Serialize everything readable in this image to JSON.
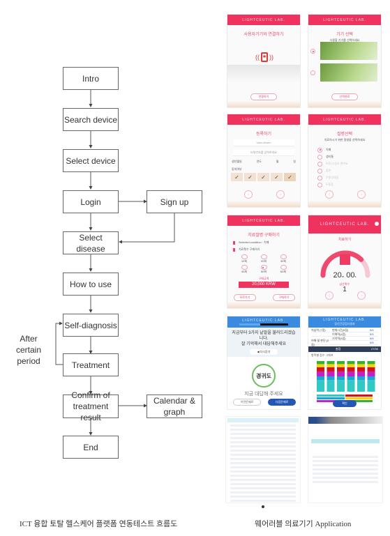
{
  "flowchart": {
    "nodes": [
      {
        "id": "intro",
        "label": "Intro"
      },
      {
        "id": "search_device",
        "label": "Search device"
      },
      {
        "id": "select_device",
        "label": "Select device"
      },
      {
        "id": "login",
        "label": "Login"
      },
      {
        "id": "sign_up",
        "label": "Sign up"
      },
      {
        "id": "select_disease",
        "label": "Select disease"
      },
      {
        "id": "how_to_use",
        "label": "How to use"
      },
      {
        "id": "self_diagnosis",
        "label": "Self-diagnosis"
      },
      {
        "id": "treatment",
        "label": "Treatment"
      },
      {
        "id": "confirm",
        "label": "Confirm of\ntreatment result"
      },
      {
        "id": "calendar",
        "label": "Calendar &\ngraph"
      },
      {
        "id": "end",
        "label": "End"
      }
    ],
    "edges": [
      [
        "intro",
        "search_device"
      ],
      [
        "search_device",
        "select_device"
      ],
      [
        "select_device",
        "login"
      ],
      [
        "login",
        "sign_up"
      ],
      [
        "login",
        "select_disease"
      ],
      [
        "sign_up",
        "select_disease"
      ],
      [
        "select_disease",
        "how_to_use"
      ],
      [
        "how_to_use",
        "self_diagnosis"
      ],
      [
        "self_diagnosis",
        "treatment"
      ],
      [
        "treatment",
        "self_diagnosis"
      ],
      [
        "treatment",
        "confirm"
      ],
      [
        "confirm",
        "calendar"
      ],
      [
        "confirm",
        "end"
      ]
    ],
    "loop_note": "After\ncertain period",
    "caption": "ICT 융합 토탈 헬스케어 플랫폼 연동테스트 흐름도"
  },
  "app": {
    "brand": "LIGHTCEUTIC LAB.",
    "caption": "웨어러블 의료기기 Application",
    "screens": {
      "connect": {
        "title": "사용자기기와 연결하기",
        "button": "연결하기"
      },
      "device_select": {
        "title": "기기 선택",
        "subtitle": "사용할 기기를 선택하세요",
        "button": "선택완료"
      },
      "register": {
        "title": "등록하기",
        "fields": [
          "User-ahuen",
          "비밀번호를 입력하세요"
        ],
        "birth_label": "생년월일",
        "birth_parts": [
          "연도",
          "월",
          "일"
        ],
        "check_label": "동의여부"
      },
      "disease": {
        "title": "질병선택",
        "subtitle": "치료하시기 위한 질병을 선택하세요",
        "options": [
          {
            "label": "치매",
            "selected": true,
            "enabled": true
          },
          {
            "label": "생리통",
            "selected": false,
            "enabled": true
          },
          {
            "label": "피로가 많이 쌓여요",
            "selected": false,
            "enabled": false
          },
          {
            "label": "불면",
            "selected": false,
            "enabled": false
          },
          {
            "label": "우울장애증",
            "selected": false,
            "enabled": false
          },
          {
            "label": "두통증",
            "selected": false,
            "enabled": false
          }
        ]
      },
      "purchase": {
        "title": "치료절병 구매하기",
        "selected_condition": "Selected condition : 치매",
        "count_label": "치료횟수 구매하기",
        "options": [
          "10회",
          "20회",
          "30회",
          "40회",
          "50회",
          "60회"
        ],
        "selected_index": 4,
        "price_label": "구매금액",
        "price": "20,000 KRW",
        "back_button": "뒤로가기",
        "buy_button": "구매하기"
      },
      "treatment": {
        "title": "치료하기",
        "time_min": "20",
        "time_sec": "00",
        "min_unit": "m",
        "sec_unit": "s",
        "remaining_label": "남은횟수",
        "remaining": "1",
        "progress": 0.75
      },
      "memory_test": {
        "instruction": "지금부터 3가지 낱말을 불러드리겠습니다.\n잘 기억해서 대답해주세요",
        "replay_button": "다시듣기",
        "word": "경귀도",
        "prompt": "지금 대답해 주세요",
        "prev_button": "이전문제로",
        "next_button": "다음문제로"
      },
      "results": {
        "subtitle": "정신건강검사결과",
        "rows": [
          {
            "label": "지남력 (7점)",
            "item": "현재시간(5점)",
            "score": "5/5"
          },
          {
            "label": "",
            "item": "이해력(4점)",
            "score": "5/5"
          },
          {
            "label": "",
            "item": "기억력(5점)",
            "score": "5/5"
          },
          {
            "label": "이해 및 판단 (2점)",
            "item": "",
            "score": "5/5"
          }
        ],
        "total_label": "총점",
        "total": "27/30",
        "chart_title": "항목별 점수 그래프",
        "confirm_button": "확인"
      }
    }
  },
  "colors": {
    "brand_pink": "#f0325e",
    "blue": "#3a8be0",
    "navy": "#2f3e56"
  }
}
